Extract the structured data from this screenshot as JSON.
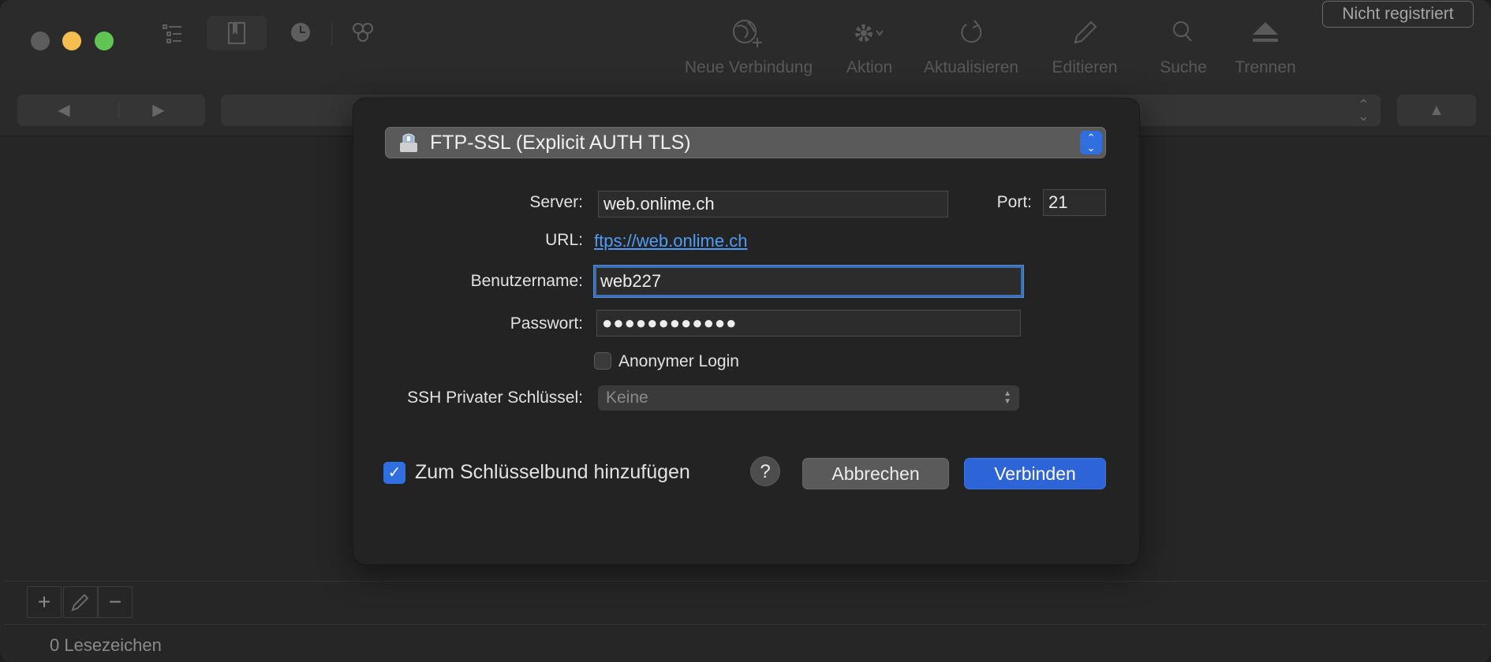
{
  "toolbar": {
    "not_registered": "Nicht registriert",
    "tools": [
      {
        "label": "Neue Verbindung",
        "icon": "globe-plus-icon"
      },
      {
        "label": "Aktion",
        "icon": "gear-icon"
      },
      {
        "label": "Aktualisieren",
        "icon": "refresh-icon"
      },
      {
        "label": "Editieren",
        "icon": "pencil-icon"
      },
      {
        "label": "Suche",
        "icon": "search-icon"
      },
      {
        "label": "Trennen",
        "icon": "eject-icon"
      }
    ]
  },
  "dialog": {
    "protocol": "FTP-SSL (Explicit AUTH TLS)",
    "server_label": "Server:",
    "server_value": "web.onlime.ch",
    "port_label": "Port:",
    "port_value": "21",
    "url_label": "URL:",
    "url_value": "ftps://web.onlime.ch",
    "username_label": "Benutzername:",
    "username_value": "web227",
    "password_label": "Passwort:",
    "password_value": "●●●●●●●●●●●●",
    "anonymous_label": "Anonymer Login",
    "anonymous_checked": false,
    "ssh_label": "SSH Privater Schlüssel:",
    "ssh_value": "Keine",
    "keychain_label": "Zum Schlüsselbund hinzufügen",
    "keychain_checked": true,
    "help_label": "?",
    "cancel_label": "Abbrechen",
    "connect_label": "Verbinden"
  },
  "status": {
    "bookmarks": "0 Lesezeichen"
  },
  "colors": {
    "accent": "#2d65d8",
    "link": "#4e9cf5",
    "focus_ring": "#3b6fb6"
  }
}
